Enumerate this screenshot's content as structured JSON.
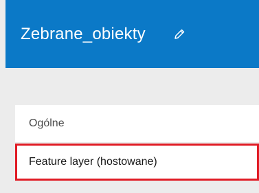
{
  "header": {
    "title": "Zebrane_obiekty",
    "edit_icon": "pencil-icon",
    "background": "#0b79c7"
  },
  "menu": {
    "items": [
      {
        "label": "Ogólne",
        "selected": false
      },
      {
        "label": "Feature layer (hostowane)",
        "selected": true
      }
    ],
    "highlight_color": "#e01b24"
  }
}
